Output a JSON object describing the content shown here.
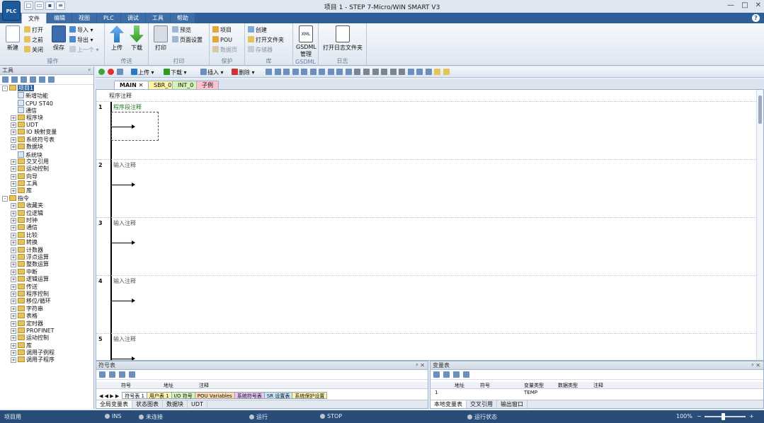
{
  "window": {
    "title": "项目 1 - STEP 7-Micro/WIN SMART V3",
    "logo": "PLC",
    "controls": [
      "—",
      "□",
      "✕"
    ]
  },
  "ribbon": {
    "tabs": [
      "文件",
      "编辑",
      "视图",
      "PLC",
      "调试",
      "工具",
      "帮助"
    ],
    "groups": {
      "operation": {
        "label": "操作",
        "new": "新建",
        "open": "打开",
        "previous": "之前",
        "close": "关闭",
        "save": "保存",
        "import": "导入",
        "export": "导出",
        "last": "上一个"
      },
      "transfer": {
        "label": "传送",
        "upload": "上传",
        "download": "下载"
      },
      "print": {
        "label": "打印",
        "print": "打印",
        "preview": "预览",
        "page_setup": "页面设置"
      },
      "protect": {
        "label": "保护",
        "project": "项目",
        "pou": "POU",
        "data_page": "数据页"
      },
      "library": {
        "label": "库",
        "create": "创建",
        "open_folder": "打开文件夹",
        "memory": "存储器"
      },
      "gsdml": {
        "label": "GSDML",
        "manage": "GSDML 管理",
        "xml": "XML"
      },
      "log": {
        "label": "日志",
        "open_log_folder": "打开日志文件夹"
      }
    }
  },
  "left_panel": {
    "title": "工具",
    "tree": [
      {
        "label": "项目1",
        "level": 0,
        "exp": "-",
        "icon": "project",
        "selected": true
      },
      {
        "label": "新增功能",
        "level": 1,
        "exp": "",
        "icon": "leaf"
      },
      {
        "label": "CPU ST40",
        "level": 1,
        "exp": "",
        "icon": "leaf"
      },
      {
        "label": "通信",
        "level": 1,
        "exp": "",
        "icon": "leaf"
      },
      {
        "label": "程序块",
        "level": 1,
        "exp": "+",
        "icon": "folder"
      },
      {
        "label": "UDT",
        "level": 1,
        "exp": "+",
        "icon": "folder"
      },
      {
        "label": "IO 映射变量",
        "level": 1,
        "exp": "+",
        "icon": "folder"
      },
      {
        "label": "系统符号表",
        "level": 1,
        "exp": "+",
        "icon": "folder"
      },
      {
        "label": "数据块",
        "level": 1,
        "exp": "+",
        "icon": "folder"
      },
      {
        "label": "系统块",
        "level": 1,
        "exp": "",
        "icon": "leaf"
      },
      {
        "label": "交叉引用",
        "level": 1,
        "exp": "+",
        "icon": "folder"
      },
      {
        "label": "运动控制",
        "level": 1,
        "exp": "+",
        "icon": "folder"
      },
      {
        "label": "向导",
        "level": 1,
        "exp": "+",
        "icon": "folder"
      },
      {
        "label": "工具",
        "level": 1,
        "exp": "+",
        "icon": "folder"
      },
      {
        "label": "库",
        "level": 1,
        "exp": "+",
        "icon": "folder"
      },
      {
        "label": "指令",
        "level": 0,
        "exp": "-",
        "icon": "folder"
      },
      {
        "label": "收藏夹",
        "level": 1,
        "exp": "+",
        "icon": "folder"
      },
      {
        "label": "位逻辑",
        "level": 1,
        "exp": "+",
        "icon": "folder"
      },
      {
        "label": "时钟",
        "level": 1,
        "exp": "+",
        "icon": "folder"
      },
      {
        "label": "通信",
        "level": 1,
        "exp": "+",
        "icon": "folder"
      },
      {
        "label": "比较",
        "level": 1,
        "exp": "+",
        "icon": "folder"
      },
      {
        "label": "转换",
        "level": 1,
        "exp": "+",
        "icon": "folder"
      },
      {
        "label": "计数器",
        "level": 1,
        "exp": "+",
        "icon": "folder"
      },
      {
        "label": "浮点运算",
        "level": 1,
        "exp": "+",
        "icon": "folder"
      },
      {
        "label": "整数运算",
        "level": 1,
        "exp": "+",
        "icon": "folder"
      },
      {
        "label": "中断",
        "level": 1,
        "exp": "+",
        "icon": "folder"
      },
      {
        "label": "逻辑运算",
        "level": 1,
        "exp": "+",
        "icon": "folder"
      },
      {
        "label": "传送",
        "level": 1,
        "exp": "+",
        "icon": "folder"
      },
      {
        "label": "程序控制",
        "level": 1,
        "exp": "+",
        "icon": "folder"
      },
      {
        "label": "移位/循环",
        "level": 1,
        "exp": "+",
        "icon": "folder"
      },
      {
        "label": "字符串",
        "level": 1,
        "exp": "+",
        "icon": "folder"
      },
      {
        "label": "表格",
        "level": 1,
        "exp": "+",
        "icon": "folder"
      },
      {
        "label": "定时器",
        "level": 1,
        "exp": "+",
        "icon": "folder"
      },
      {
        "label": "PROFINET",
        "level": 1,
        "exp": "+",
        "icon": "folder"
      },
      {
        "label": "运动控制",
        "level": 1,
        "exp": "+",
        "icon": "folder"
      },
      {
        "label": "库",
        "level": 1,
        "exp": "+",
        "icon": "folder"
      },
      {
        "label": "调用子例程",
        "level": 1,
        "exp": "+",
        "icon": "folder"
      },
      {
        "label": "调用子程序",
        "level": 1,
        "exp": "+",
        "icon": "folder"
      }
    ]
  },
  "editor_toolbar": {
    "upload": "上传",
    "download": "下载",
    "insert": "插入",
    "delete": "删除"
  },
  "editor_tabs": [
    "MAIN",
    "SBR_0",
    "INT_0",
    "子例"
  ],
  "editor": {
    "program_comment": "程序注释",
    "networks": [
      {
        "num": "1",
        "comment": "程序段注释"
      },
      {
        "num": "2",
        "comment": "输入注释"
      },
      {
        "num": "3",
        "comment": "输入注释"
      },
      {
        "num": "4",
        "comment": "输入注释"
      },
      {
        "num": "5",
        "comment": "输入注释"
      }
    ]
  },
  "symbol_panel": {
    "title": "符号表",
    "headers": [
      "符号",
      "地址",
      "注释"
    ],
    "table_tabs": [
      "符号表 1",
      "用户表 1",
      "I/O 符号",
      "POU Variables",
      "系统符号表",
      "SR 设置表",
      "系统保护设置"
    ],
    "bottom_tabs": [
      "全局变量表",
      "状态图表",
      "数据块",
      "UDT"
    ]
  },
  "var_panel": {
    "title": "变量表",
    "headers": [
      "地址",
      "符号",
      "变量类型",
      "数据类型",
      "注释"
    ],
    "row_num": "1",
    "row_var_type": "TEMP",
    "bottom_tabs": [
      "本地变量表",
      "交叉引用",
      "输出窗口"
    ]
  },
  "statusbar": {
    "left": "项目用",
    "ins": "INS",
    "conn": "未连接",
    "mode": "运行",
    "stop": "STOP",
    "plc_status": "运行状态",
    "zoom": "100%"
  }
}
